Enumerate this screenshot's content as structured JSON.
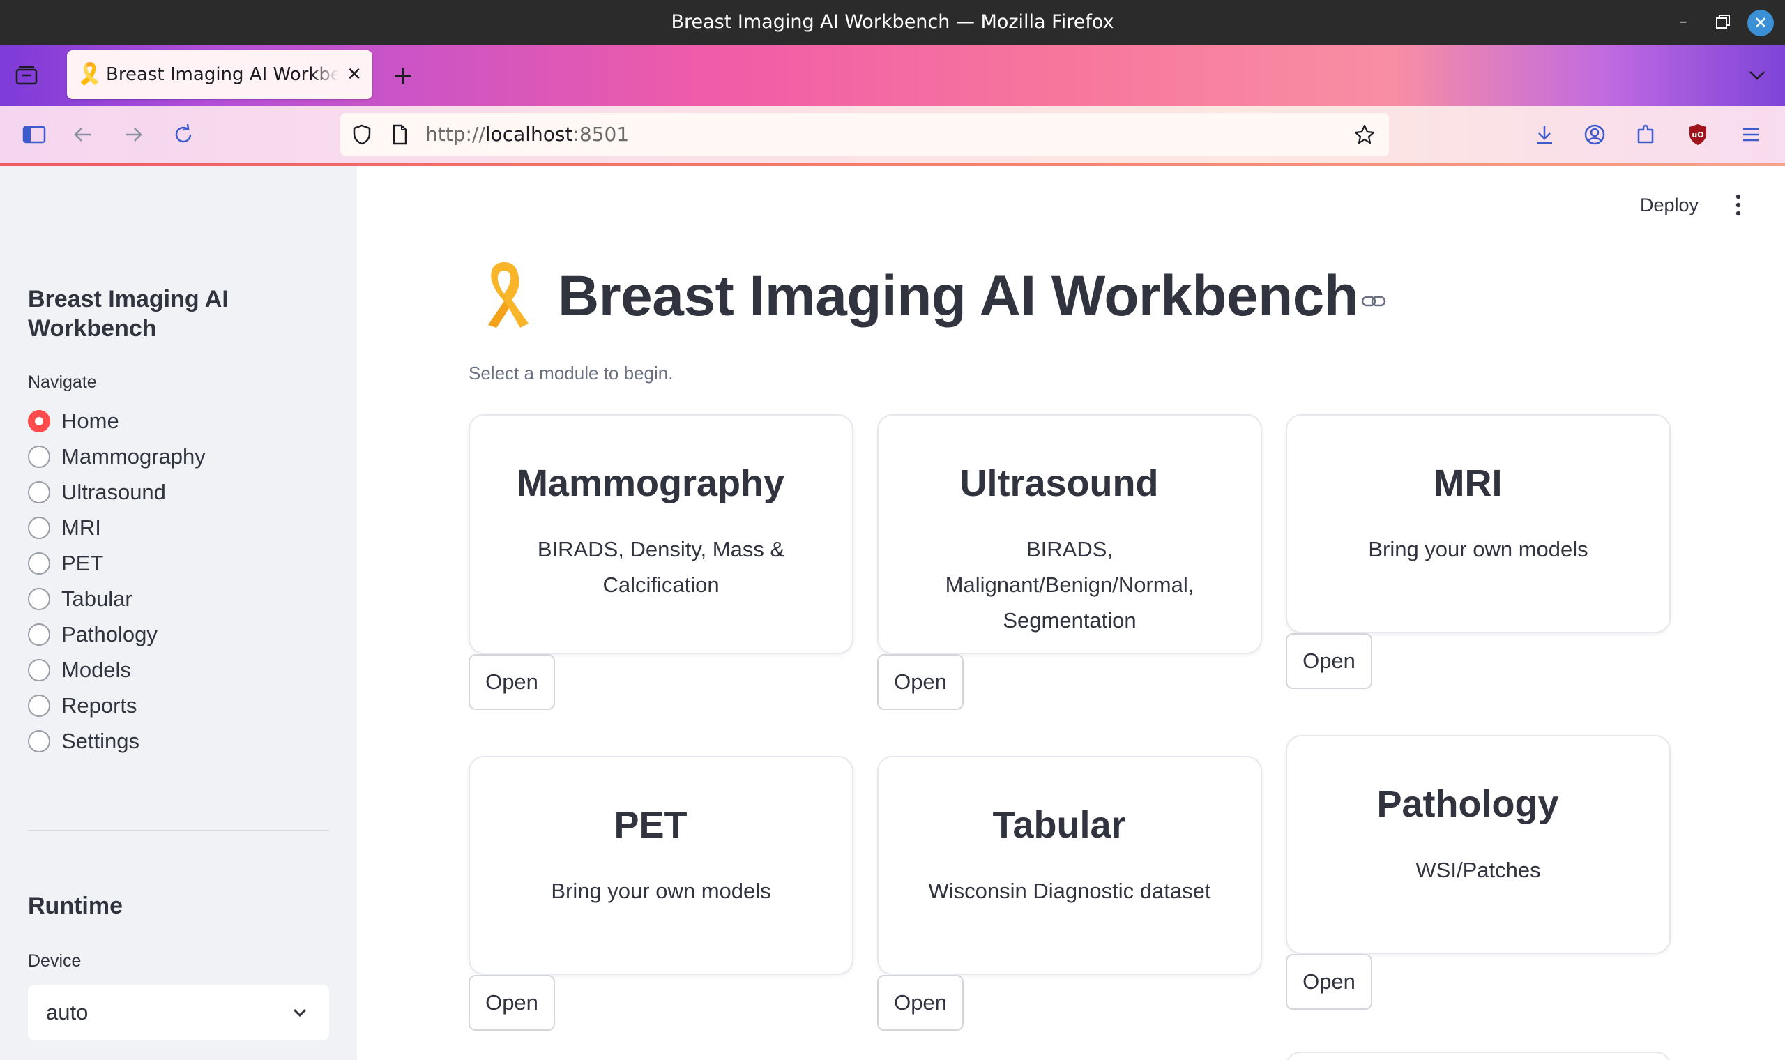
{
  "window": {
    "title": "Breast Imaging AI Workbench — Mozilla Firefox"
  },
  "browser": {
    "tab": {
      "favicon": "🎗️",
      "title": "Breast Imaging AI Workbench"
    },
    "url": {
      "scheme": "http://",
      "host": "localhost",
      "port": ":8501"
    },
    "icons": [
      "tab-overview-icon",
      "sidebar-toggle-icon",
      "back-icon",
      "forward-icon",
      "reload-icon",
      "shield-icon",
      "page-icon",
      "bookmark-star-icon",
      "download-icon",
      "account-icon",
      "extensions-icon",
      "ublock-icon",
      "menu-icon"
    ]
  },
  "sidebar": {
    "app_title": "Breast Imaging AI Workbench",
    "nav_label": "Navigate",
    "nav_items": [
      {
        "label": "Home",
        "checked": true
      },
      {
        "label": "Mammography",
        "checked": false
      },
      {
        "label": "Ultrasound",
        "checked": false
      },
      {
        "label": "MRI",
        "checked": false
      },
      {
        "label": "PET",
        "checked": false
      },
      {
        "label": "Tabular",
        "checked": false
      },
      {
        "label": "Pathology",
        "checked": false
      },
      {
        "label": "Models",
        "checked": false
      },
      {
        "label": "Reports",
        "checked": false
      },
      {
        "label": "Settings",
        "checked": false
      }
    ],
    "runtime_header": "Runtime",
    "device_label": "Device",
    "device_value": "auto"
  },
  "toolbar": {
    "deploy_label": "Deploy"
  },
  "main": {
    "title_emoji": "🎗️",
    "title": "Breast Imaging AI Workbench",
    "subtitle": "Select a module to begin.",
    "cards": [
      {
        "title": "Mammography",
        "description": "BIRADS, Density, Mass & Calcification",
        "button": "Open"
      },
      {
        "title": "Ultrasound",
        "description": "BIRADS, Malignant/Benign/Normal, Segmentation",
        "button": "Open"
      },
      {
        "title": "MRI",
        "description": "Bring your own models",
        "button": "Open"
      },
      {
        "title": "PET",
        "description": "Bring your own models",
        "button": "Open"
      },
      {
        "title": "Tabular",
        "description": "Wisconsin Diagnostic dataset",
        "button": "Open"
      },
      {
        "title": "Pathology",
        "description": "WSI/Patches",
        "button": "Open"
      }
    ]
  },
  "colors": {
    "accent": "#ff4b4b",
    "sidebar_bg": "#f0f2f6",
    "text": "#31333f"
  }
}
